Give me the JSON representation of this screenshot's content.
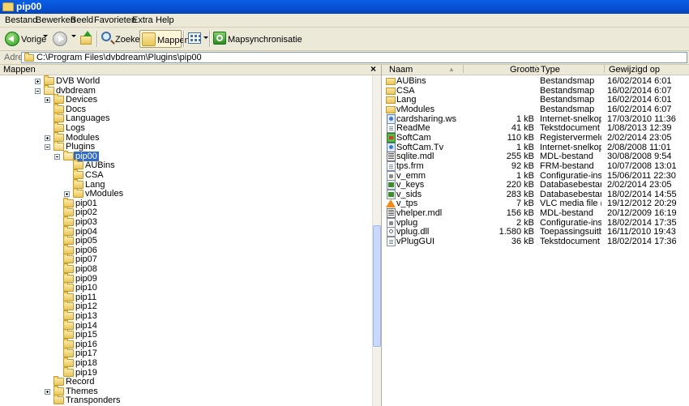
{
  "window": {
    "title": "pip00"
  },
  "menu": [
    "Bestand",
    "Bewerken",
    "Beeld",
    "Favorieten",
    "Extra",
    "Help"
  ],
  "toolbar": {
    "back_label": "Vorige",
    "search_label": "Zoeken",
    "folders_label": "Mappen",
    "sync_label": "Mapsynchronisatie"
  },
  "address": {
    "label": "Adres",
    "path": "C:\\Program Files\\dvbdream\\Plugins\\pip00"
  },
  "left_pane": {
    "title": "Mappen",
    "close": "×",
    "tree": [
      {
        "label": "DVB World",
        "level": 0,
        "expander": "plus",
        "selected": false
      },
      {
        "label": "dvbdream",
        "level": 0,
        "expander": "minus",
        "selected": false
      },
      {
        "label": "Devices",
        "level": 1,
        "expander": "plus",
        "selected": false
      },
      {
        "label": "Docs",
        "level": 1,
        "expander": "",
        "selected": false
      },
      {
        "label": "Languages",
        "level": 1,
        "expander": "",
        "selected": false
      },
      {
        "label": "Logs",
        "level": 1,
        "expander": "",
        "selected": false
      },
      {
        "label": "Modules",
        "level": 1,
        "expander": "plus",
        "selected": false
      },
      {
        "label": "Plugins",
        "level": 1,
        "expander": "minus",
        "selected": false
      },
      {
        "label": "pip00",
        "level": 2,
        "expander": "minus",
        "selected": true
      },
      {
        "label": "AUBins",
        "level": 3,
        "expander": "",
        "selected": false
      },
      {
        "label": "CSA",
        "level": 3,
        "expander": "",
        "selected": false
      },
      {
        "label": "Lang",
        "level": 3,
        "expander": "",
        "selected": false
      },
      {
        "label": "vModules",
        "level": 3,
        "expander": "plus",
        "selected": false
      },
      {
        "label": "pip01",
        "level": 2,
        "expander": "",
        "selected": false
      },
      {
        "label": "pip02",
        "level": 2,
        "expander": "",
        "selected": false
      },
      {
        "label": "pip03",
        "level": 2,
        "expander": "",
        "selected": false
      },
      {
        "label": "pip04",
        "level": 2,
        "expander": "",
        "selected": false
      },
      {
        "label": "pip05",
        "level": 2,
        "expander": "",
        "selected": false
      },
      {
        "label": "pip06",
        "level": 2,
        "expander": "",
        "selected": false
      },
      {
        "label": "pip07",
        "level": 2,
        "expander": "",
        "selected": false
      },
      {
        "label": "pip08",
        "level": 2,
        "expander": "",
        "selected": false
      },
      {
        "label": "pip09",
        "level": 2,
        "expander": "",
        "selected": false
      },
      {
        "label": "pip10",
        "level": 2,
        "expander": "",
        "selected": false
      },
      {
        "label": "pip11",
        "level": 2,
        "expander": "",
        "selected": false
      },
      {
        "label": "pip12",
        "level": 2,
        "expander": "",
        "selected": false
      },
      {
        "label": "pip13",
        "level": 2,
        "expander": "",
        "selected": false
      },
      {
        "label": "pip14",
        "level": 2,
        "expander": "",
        "selected": false
      },
      {
        "label": "pip15",
        "level": 2,
        "expander": "",
        "selected": false
      },
      {
        "label": "pip16",
        "level": 2,
        "expander": "",
        "selected": false
      },
      {
        "label": "pip17",
        "level": 2,
        "expander": "",
        "selected": false
      },
      {
        "label": "pip18",
        "level": 2,
        "expander": "",
        "selected": false
      },
      {
        "label": "pip19",
        "level": 2,
        "expander": "",
        "selected": false
      },
      {
        "label": "Record",
        "level": 1,
        "expander": "",
        "selected": false
      },
      {
        "label": "Themes",
        "level": 1,
        "expander": "plus",
        "selected": false
      },
      {
        "label": "Transponders",
        "level": 1,
        "expander": "",
        "selected": false
      }
    ]
  },
  "file_list": {
    "columns": [
      "Naam",
      "Grootte",
      "Type",
      "Gewijzigd op"
    ],
    "rows": [
      {
        "name": "AUBins",
        "size": "",
        "type": "Bestandsmap",
        "modified": "16/02/2014 6:01",
        "icon": "folder-icon"
      },
      {
        "name": "CSA",
        "size": "",
        "type": "Bestandsmap",
        "modified": "16/02/2014 6:07",
        "icon": "folder-icon"
      },
      {
        "name": "Lang",
        "size": "",
        "type": "Bestandsmap",
        "modified": "16/02/2014 6:01",
        "icon": "folder-icon"
      },
      {
        "name": "vModules",
        "size": "",
        "type": "Bestandsmap",
        "modified": "16/02/2014 6:07",
        "icon": "folder-icon"
      },
      {
        "name": "cardsharing.ws",
        "size": "1 kB",
        "type": "Internet-snelkoppeling",
        "modified": "17/03/2010 11:36",
        "icon": "internet-shortcut-icon"
      },
      {
        "name": "ReadMe",
        "size": "41 kB",
        "type": "Tekstdocument",
        "modified": "1/08/2013 12:39",
        "icon": "text-document-icon"
      },
      {
        "name": "SoftCam",
        "size": "110 kB",
        "type": "Registervermeldingen",
        "modified": "2/02/2014 23:05",
        "icon": "registry-file-icon"
      },
      {
        "name": "SoftCam.Tv",
        "size": "1 kB",
        "type": "Internet-snelkoppeling",
        "modified": "2/08/2008 11:01",
        "icon": "internet-shortcut-icon"
      },
      {
        "name": "sqlite.mdl",
        "size": "255 kB",
        "type": "MDL-bestand",
        "modified": "30/08/2008 9:54",
        "icon": "mdl-file-icon"
      },
      {
        "name": "tps.frm",
        "size": "92 kB",
        "type": "FRM-bestand",
        "modified": "10/07/2008 13:01",
        "icon": "frm-file-icon"
      },
      {
        "name": "v_emm",
        "size": "1 kB",
        "type": "Configuratie-instelli...",
        "modified": "15/06/2011 22:30",
        "icon": "config-file-icon"
      },
      {
        "name": "v_keys",
        "size": "220 kB",
        "type": "Databasebestand",
        "modified": "2/02/2014 23:05",
        "icon": "database-file-icon"
      },
      {
        "name": "v_sids",
        "size": "283 kB",
        "type": "Databasebestand",
        "modified": "18/02/2014 14:55",
        "icon": "database-file-icon"
      },
      {
        "name": "v_tps",
        "size": "7 kB",
        "type": "VLC media file (.bin)",
        "modified": "19/12/2012 20:29",
        "icon": "vlc-cone-icon"
      },
      {
        "name": "vhelper.mdl",
        "size": "156 kB",
        "type": "MDL-bestand",
        "modified": "20/12/2009 16:19",
        "icon": "mdl-file-icon"
      },
      {
        "name": "vplug",
        "size": "2 kB",
        "type": "Configuratie-instelli...",
        "modified": "18/02/2014 17:35",
        "icon": "config-file-icon"
      },
      {
        "name": "vplug.dll",
        "size": "1.580 kB",
        "type": "Toepassingsuitbreid...",
        "modified": "16/11/2010 19:43",
        "icon": "dll-file-icon"
      },
      {
        "name": "vPlugGUI",
        "size": "36 kB",
        "type": "Tekstdocument",
        "modified": "18/02/2014 17:36",
        "icon": "text-document-icon"
      }
    ]
  },
  "colors": {
    "titlebar": "#0750d4",
    "selection": "#316ac5",
    "chrome": "#ece9d8"
  }
}
